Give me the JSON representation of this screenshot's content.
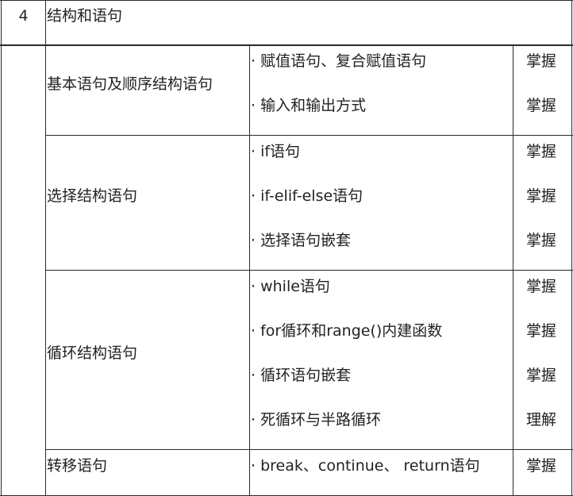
{
  "header": {
    "number": "4",
    "title": "结构和语句"
  },
  "sections": [
    {
      "name": "基本语句及顺序结构语句",
      "items": [
        {
          "text": "· 赋值语句、复合赋值语句",
          "level": "掌握"
        },
        {
          "text": "· 输入和输出方式",
          "level": "掌握"
        }
      ]
    },
    {
      "name": "选择结构语句",
      "items": [
        {
          "text": "· if语句",
          "level": "掌握"
        },
        {
          "text": "· if-elif-else语句",
          "level": "掌握"
        },
        {
          "text": "· 选择语句嵌套",
          "level": "掌握"
        }
      ]
    },
    {
      "name": "循环结构语句",
      "items": [
        {
          "text": "· while语句",
          "level": "掌握"
        },
        {
          "text": "· for循环和range()内建函数",
          "level": "掌握"
        },
        {
          "text": "· 循环语句嵌套",
          "level": "掌握"
        },
        {
          "text": "· 死循环与半路循环",
          "level": "理解"
        }
      ]
    },
    {
      "name": "转移语句",
      "items": [
        {
          "text": "· break、continue、 return语句",
          "level": "掌握"
        }
      ]
    }
  ]
}
